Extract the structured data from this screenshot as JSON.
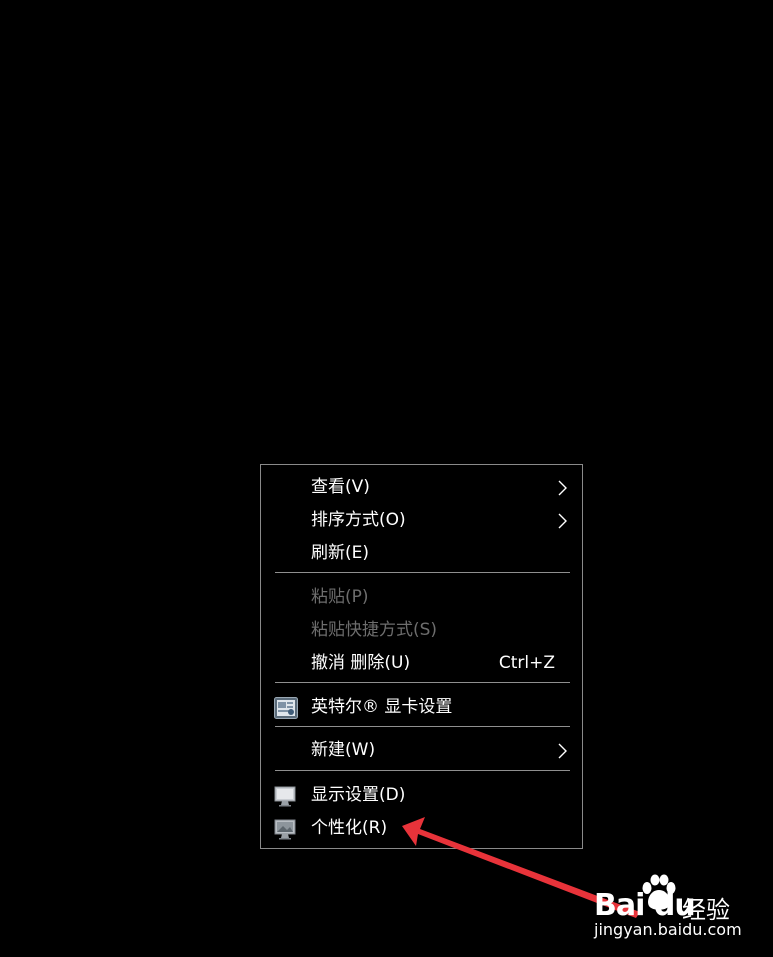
{
  "context_menu": {
    "items": [
      {
        "label": "查看(V)",
        "has_submenu": true,
        "enabled": true,
        "icon": null
      },
      {
        "label": "排序方式(O)",
        "has_submenu": true,
        "enabled": true,
        "icon": null
      },
      {
        "label": "刷新(E)",
        "has_submenu": false,
        "enabled": true,
        "icon": null
      },
      {
        "label": "粘贴(P)",
        "has_submenu": false,
        "enabled": false,
        "icon": null
      },
      {
        "label": "粘贴快捷方式(S)",
        "has_submenu": false,
        "enabled": false,
        "icon": null
      },
      {
        "label": "撤消 删除(U)",
        "shortcut": "Ctrl+Z",
        "has_submenu": false,
        "enabled": true,
        "icon": null
      },
      {
        "label": "英特尔® 显卡设置",
        "has_submenu": false,
        "enabled": true,
        "icon": "intel-graphics-icon"
      },
      {
        "label": "新建(W)",
        "has_submenu": true,
        "enabled": true,
        "icon": null
      },
      {
        "label": "显示设置(D)",
        "has_submenu": false,
        "enabled": true,
        "icon": "monitor-icon"
      },
      {
        "label": "个性化(R)",
        "has_submenu": false,
        "enabled": true,
        "icon": "personalize-monitor-icon"
      }
    ]
  },
  "colors": {
    "background": "#000000",
    "menu_border": "#8a8a8a",
    "text": "#ffffff",
    "disabled_text": "#6d6d6d",
    "annotation_arrow": "#e8333a"
  },
  "watermark": {
    "brand": "Bai du",
    "product": "经验",
    "url": "jingyan.baidu.com"
  }
}
